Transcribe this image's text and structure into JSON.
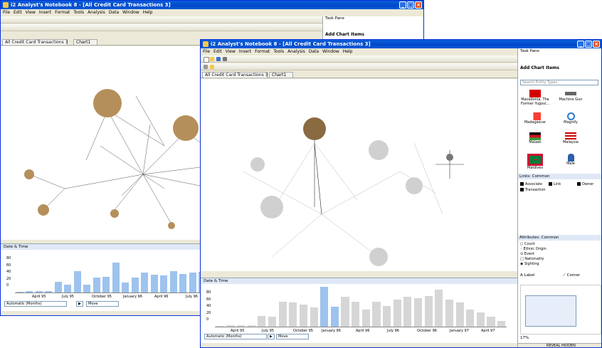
{
  "back_window": {
    "title": "i2 Analyst's Notebook 8 - [All Credit Card Transactions 3]",
    "menu": [
      "File",
      "Edit",
      "View",
      "Insert",
      "Format",
      "Tools",
      "Analysis",
      "Data",
      "Window",
      "Help"
    ],
    "tabs": [
      "All Credit Card Transactions 3",
      "Chart1"
    ],
    "task_pane_title": "Task Pane",
    "task_pane_section": "Add Chart Items",
    "date_time": {
      "title": "Date & Time",
      "y_ticks": [
        "80",
        "60",
        "40",
        "20",
        "0"
      ],
      "x_ticks": [
        "April 95",
        "July 95",
        "October 95",
        "January 96",
        "April 96",
        "July 96"
      ],
      "interval": "Automatic (Months)",
      "action": "Move"
    }
  },
  "front_window": {
    "title": "i2 Analyst's Notebook 8 - [All Credit Card Transactions 3]",
    "menu": [
      "File",
      "Edit",
      "View",
      "Insert",
      "Format",
      "Tools",
      "Analysis",
      "Data",
      "Window",
      "Help"
    ],
    "tabs": [
      "All Credit Card Transactions 3",
      "Chart1"
    ],
    "task_pane": {
      "title": "Task Pane",
      "section": "Add Chart Items",
      "search_placeholder": "Search Entity Types",
      "entities": [
        {
          "label": "Macedonia, The Former Yugosl...",
          "icon": "flag-macedonia-icon"
        },
        {
          "label": "Machine Gun",
          "icon": "machine-gun-icon"
        },
        {
          "label": "Madagascar",
          "icon": "flag-madagascar-icon"
        },
        {
          "label": "Magnify",
          "icon": "magnify-icon"
        },
        {
          "label": "Malawi",
          "icon": "flag-malawi-icon"
        },
        {
          "label": "Malaysia",
          "icon": "flag-malaysia-icon"
        },
        {
          "label": "Maldives",
          "icon": "flag-maldives-icon"
        },
        {
          "label": "Male",
          "icon": "male-icon"
        }
      ],
      "links_header": "Links: Common",
      "links": [
        "Associate",
        "Link",
        "Owner",
        "Transaction"
      ],
      "attributes_header": "Attributes: Common",
      "attributes": [
        "Count",
        "Ethnic Origin",
        "Event",
        "Nationality",
        "Sighting"
      ],
      "label_btn": "Label",
      "corner_btn": "Corner",
      "zoom": "17%",
      "status": "REVEAL HIDDEN"
    },
    "date_time": {
      "title": "Date & Time",
      "y_ticks": [
        "80",
        "60",
        "40",
        "20",
        "0"
      ],
      "x_ticks": [
        "April 95",
        "July 95",
        "October 95",
        "January 96",
        "April 96",
        "July 96",
        "October 96",
        "January 97",
        "April 97"
      ],
      "interval": "Automatic (Months)",
      "action": "Move"
    }
  },
  "chart_data": [
    {
      "type": "bar",
      "title": "Date & Time",
      "y_ticks": [
        "80",
        "60",
        "40",
        "20",
        "0"
      ],
      "ylim": [
        0,
        80
      ],
      "x_tick_labels": [
        "April 95",
        "July 95",
        "October 95",
        "January 96",
        "April 96",
        "July 96"
      ],
      "values": [
        2,
        3,
        3,
        3,
        25,
        18,
        50,
        18,
        35,
        36,
        70,
        24,
        35,
        46,
        42,
        40,
        50,
        44,
        47,
        48
      ],
      "highlighted": [],
      "color": "#9dc3ee"
    },
    {
      "type": "bar",
      "title": "Date & Time",
      "y_ticks": [
        "80",
        "60",
        "40",
        "20",
        "0"
      ],
      "ylim": [
        0,
        80
      ],
      "x_tick_labels": [
        "April 95",
        "July 95",
        "October 95",
        "January 96",
        "April 96",
        "July 96",
        "October 96",
        "January 97",
        "April 97"
      ],
      "values": [
        2,
        3,
        3,
        3,
        22,
        20,
        50,
        48,
        44,
        38,
        95,
        40,
        60,
        50,
        35,
        50,
        42,
        55,
        60,
        57,
        62,
        75,
        55,
        48,
        35,
        28,
        20,
        12
      ],
      "highlighted": [
        10,
        11
      ],
      "color": "#d6d6d6",
      "highlight_color": "#9dc3ee"
    }
  ]
}
